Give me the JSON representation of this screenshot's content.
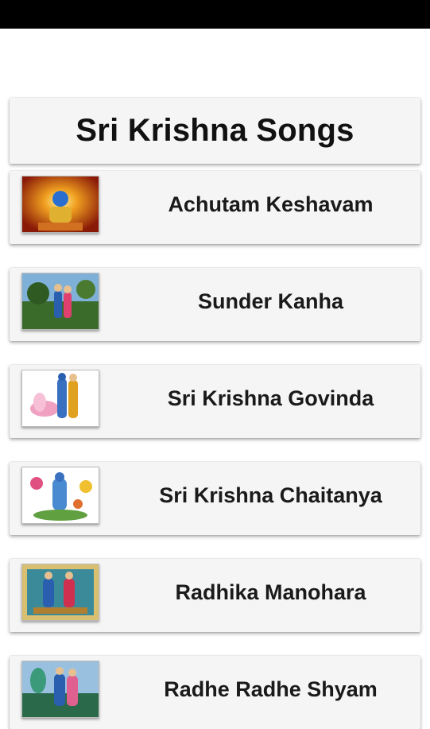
{
  "header": {
    "title": "Sri Krishna Songs"
  },
  "songs": [
    {
      "title": "Achutam Keshavam",
      "thumb_icon": "krishna-golden-aura-image",
      "thumb_colors": [
        "#8a1a08",
        "#f0a020"
      ]
    },
    {
      "title": "Sunder Kanha",
      "thumb_icon": "radha-krishna-garden-image",
      "thumb_colors": [
        "#3b6b2a",
        "#7fb0d8"
      ]
    },
    {
      "title": "Sri Krishna Govinda",
      "thumb_icon": "krishna-lotus-image",
      "thumb_colors": [
        "#ffffff",
        "#f0a0c0"
      ]
    },
    {
      "title": "Sri Krishna Chaitanya",
      "thumb_icon": "krishna-flowers-image",
      "thumb_colors": [
        "#ffffff",
        "#4a8ad0"
      ]
    },
    {
      "title": "Radhika Manohara",
      "thumb_icon": "radha-krishna-swing-image",
      "thumb_colors": [
        "#d8c070",
        "#3a8a9a"
      ]
    },
    {
      "title": "Radhe Radhe Shyam",
      "thumb_icon": "radha-krishna-peacock-image",
      "thumb_colors": [
        "#2a6a4a",
        "#9ac0e0"
      ]
    }
  ]
}
